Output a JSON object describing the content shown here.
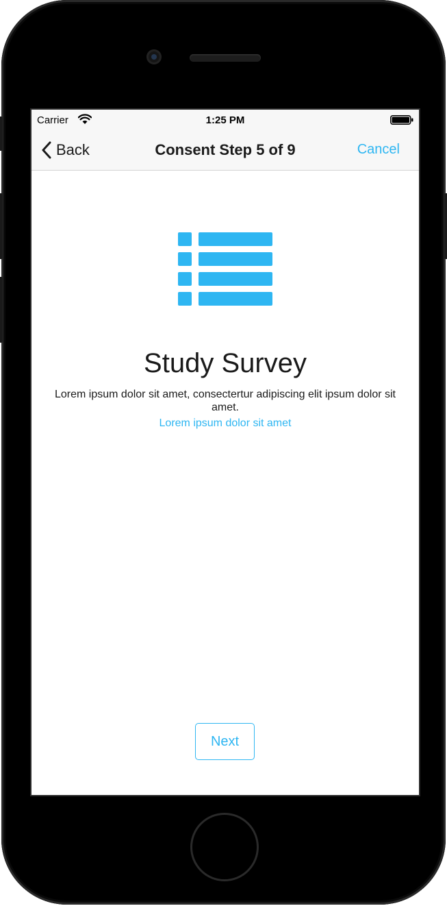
{
  "status_bar": {
    "carrier": "Carrier",
    "time": "1:25 PM"
  },
  "nav": {
    "back_label": "Back",
    "title": "Consent Step 5 of 9",
    "cancel_label": "Cancel"
  },
  "content": {
    "icon": "list-icon",
    "title": "Study Survey",
    "description": "Lorem ipsum dolor sit amet, consectertur adipiscing elit  ipsum dolor sit amet.",
    "learn_more_link": "Lorem ipsum dolor sit amet"
  },
  "footer": {
    "next_label": "Next"
  },
  "colors": {
    "accent": "#2eb6f2",
    "text": "#1a1a1a",
    "nav_background": "#f7f7f7"
  }
}
